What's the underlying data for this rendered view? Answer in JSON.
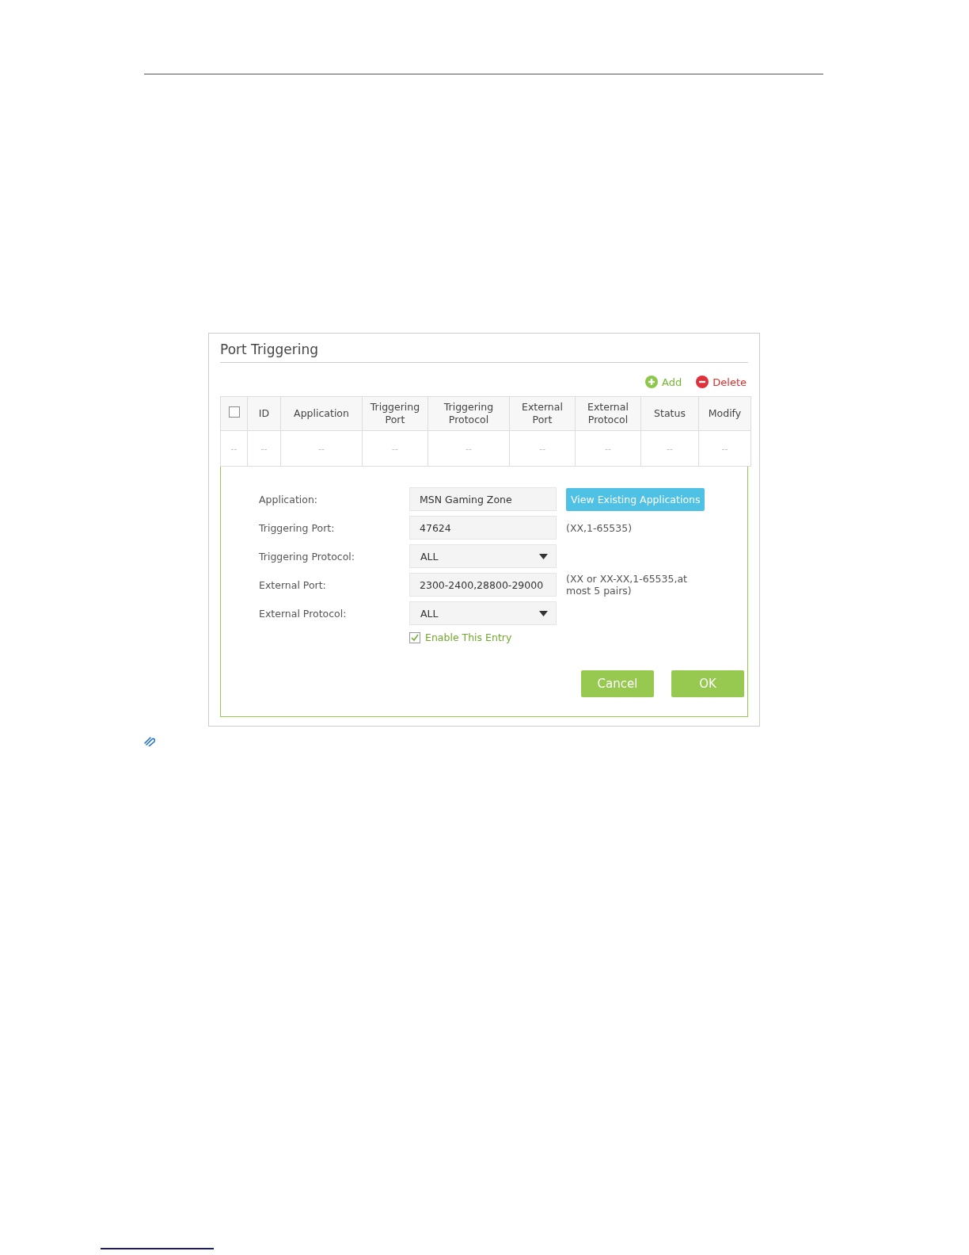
{
  "panel": {
    "title": "Port Triggering",
    "actions": [
      {
        "kind": "add",
        "label": "Add"
      },
      {
        "kind": "delete",
        "label": "Delete"
      }
    ],
    "table": {
      "columns": [
        {
          "kind": "checkbox",
          "checked": false
        },
        {
          "kind": "text",
          "label": "ID"
        },
        {
          "kind": "text",
          "label": "Application"
        },
        {
          "kind": "text",
          "label": "Triggering Port"
        },
        {
          "kind": "text",
          "label": "Triggering Protocol"
        },
        {
          "kind": "text",
          "label": "External Port"
        },
        {
          "kind": "text",
          "label": "External Protocol"
        },
        {
          "kind": "text",
          "label": "Status"
        },
        {
          "kind": "text",
          "label": "Modify"
        }
      ],
      "rows": [
        {
          "cells": [
            "--",
            "--",
            "--",
            "--",
            "--",
            "--",
            "--",
            "--",
            "--"
          ]
        }
      ]
    },
    "form": {
      "fields": [
        {
          "kind": "text",
          "label": "Application:",
          "value": "MSN Gaming Zone",
          "button": "View Existing Applications"
        },
        {
          "kind": "text",
          "label": "Triggering Port:",
          "value": "47624",
          "hint": "(XX,1-65535)"
        },
        {
          "kind": "select",
          "label": "Triggering Protocol:",
          "value": "ALL"
        },
        {
          "kind": "text",
          "label": "External Port:",
          "value": "2300-2400,28800-29000",
          "hint": "(XX or XX-XX,1-65535,at most 5 pairs)"
        },
        {
          "kind": "select",
          "label": "External Protocol:",
          "value": "ALL"
        }
      ],
      "enable": {
        "label": "Enable This Entry",
        "checked": true
      },
      "buttons": [
        "Cancel",
        "OK"
      ]
    }
  }
}
